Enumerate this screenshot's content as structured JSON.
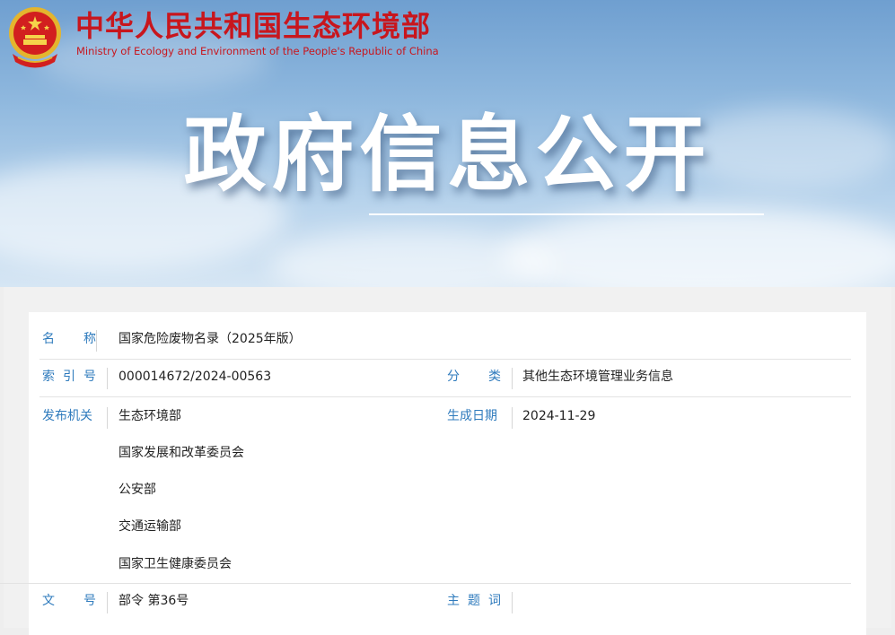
{
  "header": {
    "site_name": "中华人民共和国生态环境部",
    "site_name_en": "Ministry of Ecology and Environment of the People's Republic of China",
    "hero_title": "政府信息公开"
  },
  "colors": {
    "brand_red": "#c8161d",
    "label_blue": "#2f7bbd",
    "banner_sky": "#8fb8de"
  },
  "info": {
    "name_label": "名  称",
    "name_value": "国家危险废物名录（2025年版）",
    "index_label": "索引号",
    "index_value": "000014672/2024-00563",
    "category_label": "分  类",
    "category_value": "其他生态环境管理业务信息",
    "issuer_label": "发布机关",
    "issuers": [
      "生态环境部",
      "国家发展和改革委员会",
      "公安部",
      "交通运输部",
      "国家卫生健康委员会"
    ],
    "date_label": "生成日期",
    "date_value": "2024-11-29",
    "docno_label": "文  号",
    "docno_value": "部令 第36号",
    "subject_label": "主题词",
    "subject_value": ""
  }
}
